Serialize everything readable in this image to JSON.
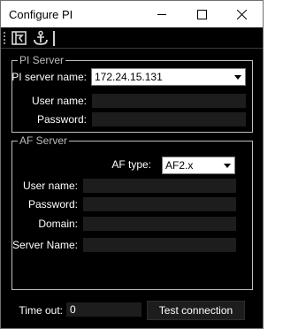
{
  "window": {
    "title": "Configure PI"
  },
  "toolbar": {
    "icons": [
      "pi-logo-icon",
      "anchor-icon"
    ]
  },
  "pi_server": {
    "legend": "PI Server",
    "server_name_label": "PI server name:",
    "server_name_value": "172.24.15.131",
    "user_name_label": "User name:",
    "user_name_value": "",
    "password_label": "Password:",
    "password_value": ""
  },
  "af_server": {
    "legend": "AF Server",
    "af_type_label": "AF type:",
    "af_type_value": "AF2.x",
    "user_name_label": "User name:",
    "user_name_value": "",
    "password_label": "Password:",
    "password_value": "",
    "domain_label": "Domain:",
    "domain_value": "",
    "server_name_label": "Server Name:",
    "server_name_value": ""
  },
  "footer": {
    "timeout_label": "Time out:",
    "timeout_value": "0",
    "test_button": "Test connection"
  }
}
